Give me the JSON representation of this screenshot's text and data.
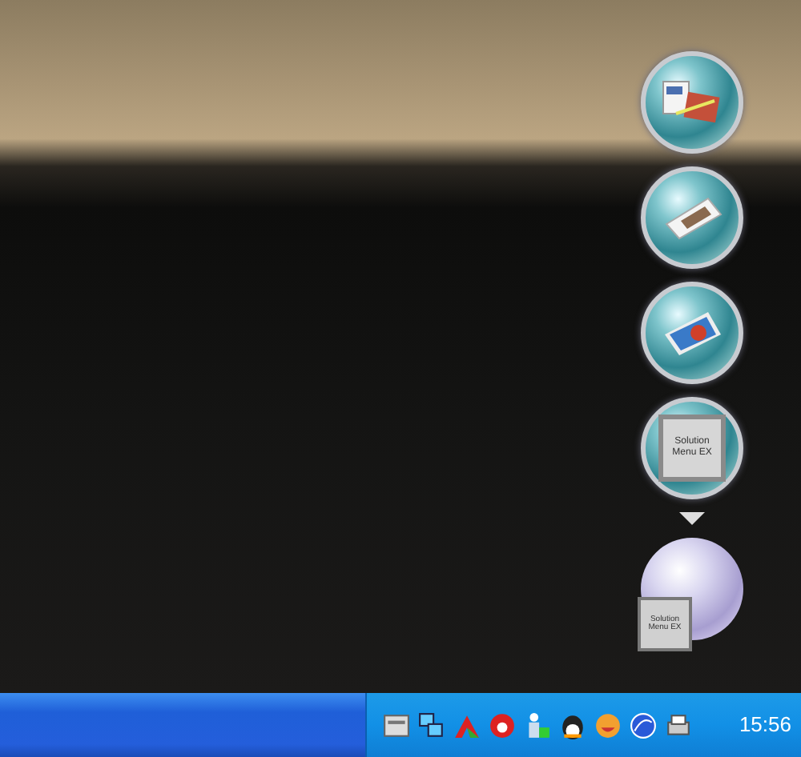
{
  "dock": {
    "items": [
      {
        "kind": "documents"
      },
      {
        "kind": "print"
      },
      {
        "kind": "photo"
      },
      {
        "kind": "solution",
        "label": "Solution Menu EX"
      }
    ],
    "launcher": {
      "label": "Solution Menu EX"
    }
  },
  "taskbar": {
    "clock": "15:56"
  }
}
